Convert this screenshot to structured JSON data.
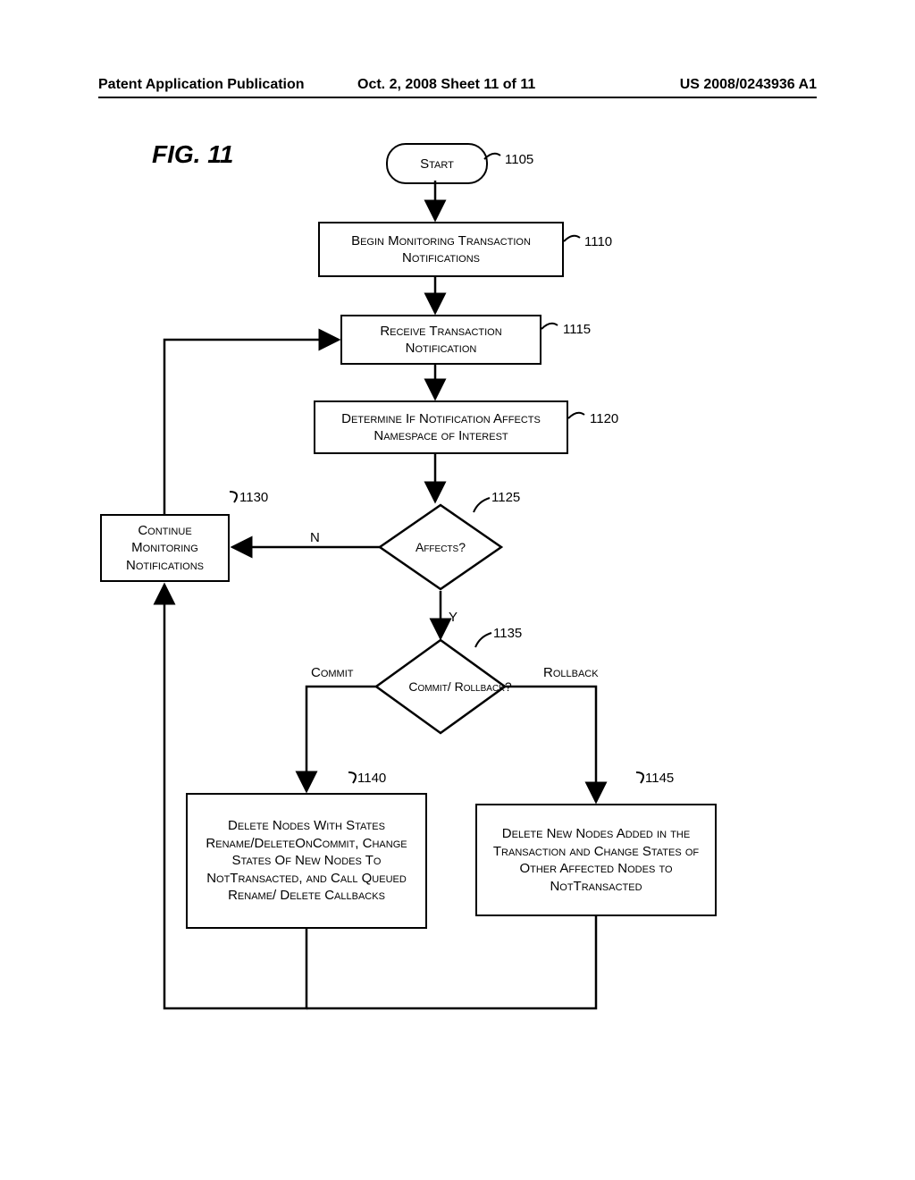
{
  "header": {
    "left": "Patent Application Publication",
    "mid": "Oct. 2, 2008  Sheet 11 of 11",
    "right": "US 2008/0243936 A1"
  },
  "figure_label": "FIG. 11",
  "nodes": {
    "start": {
      "text": "Start",
      "ref": "1105"
    },
    "begin": {
      "text": "Begin Monitoring Transaction Notifications",
      "ref": "1110"
    },
    "receive": {
      "text": "Receive Transaction Notification",
      "ref": "1115"
    },
    "determine": {
      "text": "Determine If Notification Affects Namespace of Interest",
      "ref": "1120"
    },
    "affects": {
      "text": "Affects?",
      "ref": "1125"
    },
    "continue": {
      "text": "Continue Monitoring Notifications",
      "ref": "1130"
    },
    "commitdec": {
      "text": "Commit/ Rollback?",
      "ref": "1135"
    },
    "commitbox": {
      "text": "Delete Nodes With States Rename/DeleteOnCommit, Change States Of New Nodes To NotTransacted, and Call Queued Rename/ Delete Callbacks",
      "ref": "1140"
    },
    "rollbackbox": {
      "text": "Delete New Nodes Added in the Transaction and Change States of Other Affected Nodes to NotTransacted",
      "ref": "1145"
    }
  },
  "edge_labels": {
    "affects_no": "N",
    "affects_yes": "Y",
    "commit": "Commit",
    "rollback": "Rollback"
  },
  "chart_data": {
    "type": "flowchart",
    "title": "FIG. 11",
    "nodes": [
      {
        "id": "1105",
        "type": "terminal",
        "label": "Start"
      },
      {
        "id": "1110",
        "type": "process",
        "label": "Begin Monitoring Transaction Notifications"
      },
      {
        "id": "1115",
        "type": "process",
        "label": "Receive Transaction Notification"
      },
      {
        "id": "1120",
        "type": "process",
        "label": "Determine If Notification Affects Namespace of Interest"
      },
      {
        "id": "1125",
        "type": "decision",
        "label": "Affects?"
      },
      {
        "id": "1130",
        "type": "process",
        "label": "Continue Monitoring Notifications"
      },
      {
        "id": "1135",
        "type": "decision",
        "label": "Commit / Rollback?"
      },
      {
        "id": "1140",
        "type": "process",
        "label": "Delete Nodes With States Rename/DeleteOnCommit, Change States Of New Nodes To NotTransacted, and Call Queued Rename/Delete Callbacks"
      },
      {
        "id": "1145",
        "type": "process",
        "label": "Delete New Nodes Added in the Transaction and Change States of Other Affected Nodes to NotTransacted"
      }
    ],
    "edges": [
      {
        "from": "1105",
        "to": "1110"
      },
      {
        "from": "1110",
        "to": "1115"
      },
      {
        "from": "1115",
        "to": "1120"
      },
      {
        "from": "1120",
        "to": "1125"
      },
      {
        "from": "1125",
        "to": "1130",
        "label": "N"
      },
      {
        "from": "1125",
        "to": "1135",
        "label": "Y"
      },
      {
        "from": "1135",
        "to": "1140",
        "label": "Commit"
      },
      {
        "from": "1135",
        "to": "1145",
        "label": "Rollback"
      },
      {
        "from": "1130",
        "to": "1115"
      },
      {
        "from": "1140",
        "to": "1130"
      },
      {
        "from": "1145",
        "to": "1130"
      }
    ]
  }
}
